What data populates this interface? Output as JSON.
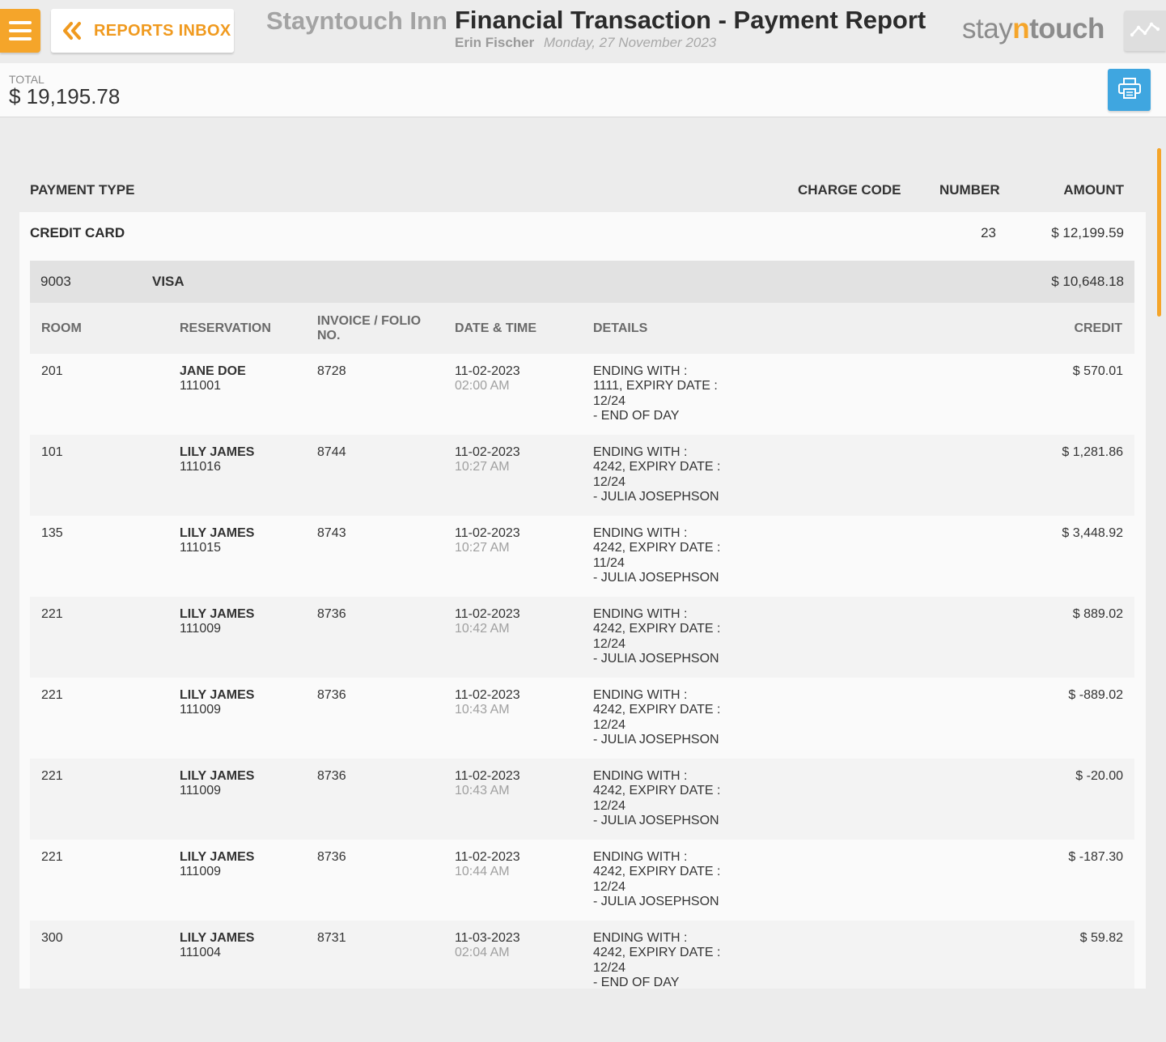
{
  "header": {
    "inbox_label": "REPORTS INBOX",
    "hotel_name": "Stayntouch Inn",
    "report_title": "Financial Transaction - Payment Report",
    "user": "Erin Fischer",
    "date": "Monday, 27 November 2023",
    "brand": {
      "stay": "stay",
      "n": "n",
      "touch": "touch"
    }
  },
  "total": {
    "label": "TOTAL",
    "value": "$ 19,195.78"
  },
  "columns": {
    "payment_type": "PAYMENT TYPE",
    "charge_code": "CHARGE CODE",
    "number": "NUMBER",
    "amount": "AMOUNT"
  },
  "credit_card": {
    "label": "CREDIT CARD",
    "number": "23",
    "amount": "$ 12,199.59",
    "card": {
      "code": "9003",
      "name": "VISA",
      "amount": "$ 10,648.18",
      "table_headers": {
        "room": "ROOM",
        "reservation": "RESERVATION",
        "invoice_1": "INVOICE / FOLIO",
        "invoice_2": "NO.",
        "datetime": "DATE & TIME",
        "details": "DETAILS",
        "credit": "CREDIT"
      },
      "rows": [
        {
          "room": "201",
          "guest": "JANE DOE",
          "res_no": "111001",
          "invoice": "8728",
          "date": "11-02-2023",
          "time": "02:00 AM",
          "d1": "ENDING WITH :",
          "d2": "1111, EXPIRY DATE :",
          "d3": "12/24",
          "d4": "- END OF DAY",
          "credit": "$ 570.01"
        },
        {
          "room": "101",
          "guest": "LILY JAMES",
          "res_no": "111016",
          "invoice": "8744",
          "date": "11-02-2023",
          "time": "10:27 AM",
          "d1": "ENDING WITH :",
          "d2": "4242, EXPIRY DATE :",
          "d3": "12/24",
          "d4": "- JULIA JOSEPHSON",
          "credit": "$ 1,281.86"
        },
        {
          "room": "135",
          "guest": "LILY JAMES",
          "res_no": "111015",
          "invoice": "8743",
          "date": "11-02-2023",
          "time": "10:27 AM",
          "d1": "ENDING WITH :",
          "d2": "4242, EXPIRY DATE :",
          "d3": "11/24",
          "d4": "- JULIA JOSEPHSON",
          "credit": "$ 3,448.92"
        },
        {
          "room": "221",
          "guest": "LILY JAMES",
          "res_no": "111009",
          "invoice": "8736",
          "date": "11-02-2023",
          "time": "10:42 AM",
          "d1": "ENDING WITH :",
          "d2": "4242, EXPIRY DATE :",
          "d3": "12/24",
          "d4": "- JULIA JOSEPHSON",
          "credit": "$ 889.02"
        },
        {
          "room": "221",
          "guest": "LILY JAMES",
          "res_no": "111009",
          "invoice": "8736",
          "date": "11-02-2023",
          "time": "10:43 AM",
          "d1": "ENDING WITH :",
          "d2": "4242, EXPIRY DATE :",
          "d3": "12/24",
          "d4": "- JULIA JOSEPHSON",
          "credit": "$ -889.02"
        },
        {
          "room": "221",
          "guest": "LILY JAMES",
          "res_no": "111009",
          "invoice": "8736",
          "date": "11-02-2023",
          "time": "10:43 AM",
          "d1": "ENDING WITH :",
          "d2": "4242, EXPIRY DATE :",
          "d3": "12/24",
          "d4": "- JULIA JOSEPHSON",
          "credit": "$ -20.00"
        },
        {
          "room": "221",
          "guest": "LILY JAMES",
          "res_no": "111009",
          "invoice": "8736",
          "date": "11-02-2023",
          "time": "10:44 AM",
          "d1": "ENDING WITH :",
          "d2": "4242, EXPIRY DATE :",
          "d3": "12/24",
          "d4": "- JULIA JOSEPHSON",
          "credit": "$ -187.30"
        },
        {
          "room": "300",
          "guest": "LILY JAMES",
          "res_no": "111004",
          "invoice": "8731",
          "date": "11-03-2023",
          "time": "02:04 AM",
          "d1": "ENDING WITH :",
          "d2": "4242, EXPIRY DATE :",
          "d3": "12/24",
          "d4": "- END OF DAY",
          "credit": "$ 59.82"
        }
      ]
    }
  },
  "icons": {
    "menu": "hamburger-icon",
    "back": "double-chevron-left-icon",
    "graph": "line-graph-icon",
    "print": "printer-icon"
  },
  "colors": {
    "accent": "#f5a52a",
    "print_button": "#3fa6e0"
  }
}
